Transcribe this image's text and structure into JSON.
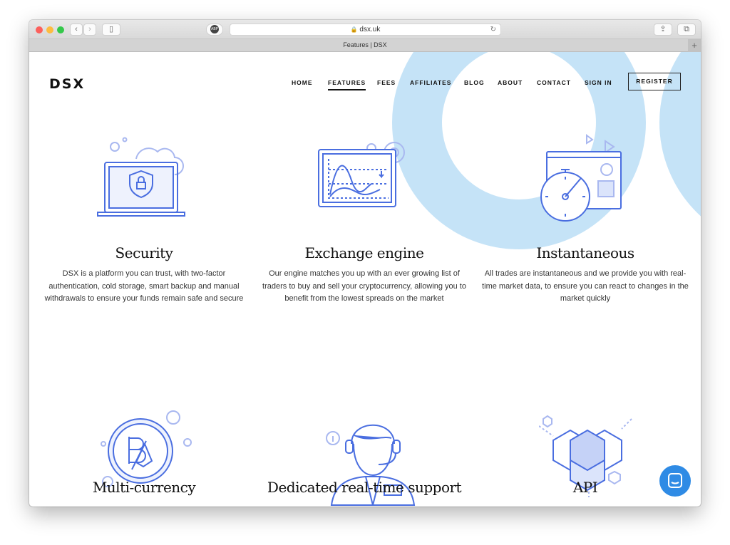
{
  "browser": {
    "url": "dsx.uk",
    "tab_title": "Features | DSX",
    "abp_label": "ABP"
  },
  "header": {
    "logo": "DSX",
    "nav": [
      {
        "label": "HOME"
      },
      {
        "label": "FEATURES",
        "active": true
      },
      {
        "label": "FEES"
      },
      {
        "label": "AFFILIATES"
      },
      {
        "label": "BLOG"
      },
      {
        "label": "ABOUT"
      },
      {
        "label": "CONTACT"
      },
      {
        "label": "SIGN IN"
      }
    ],
    "register": "REGISTER"
  },
  "features": [
    {
      "title": "Security",
      "text": "DSX is a platform you can trust, with two-factor authentication, cold storage, smart backup and manual withdrawals to ensure your funds remain safe and secure",
      "icon": "laptop-shield-icon"
    },
    {
      "title": "Exchange engine",
      "text": "Our engine matches you up with an ever growing list of traders to buy and sell your cryptocurrency, allowing you to benefit from the lowest spreads on the market",
      "icon": "chart-gears-icon"
    },
    {
      "title": "Instantaneous",
      "text": "All trades are instantaneous and we provide you with real-time market data, to ensure you can react to changes in the market quickly",
      "icon": "stopwatch-icon"
    },
    {
      "title": "Multi-currency",
      "icon": "coin-icon"
    },
    {
      "title": "Dedicated real-time support",
      "icon": "support-agent-icon"
    },
    {
      "title": "API",
      "icon": "cubes-icon"
    }
  ],
  "colors": {
    "accent": "#4a6ee0",
    "ring": "#c5e3f7",
    "chat": "#2f8be5"
  }
}
